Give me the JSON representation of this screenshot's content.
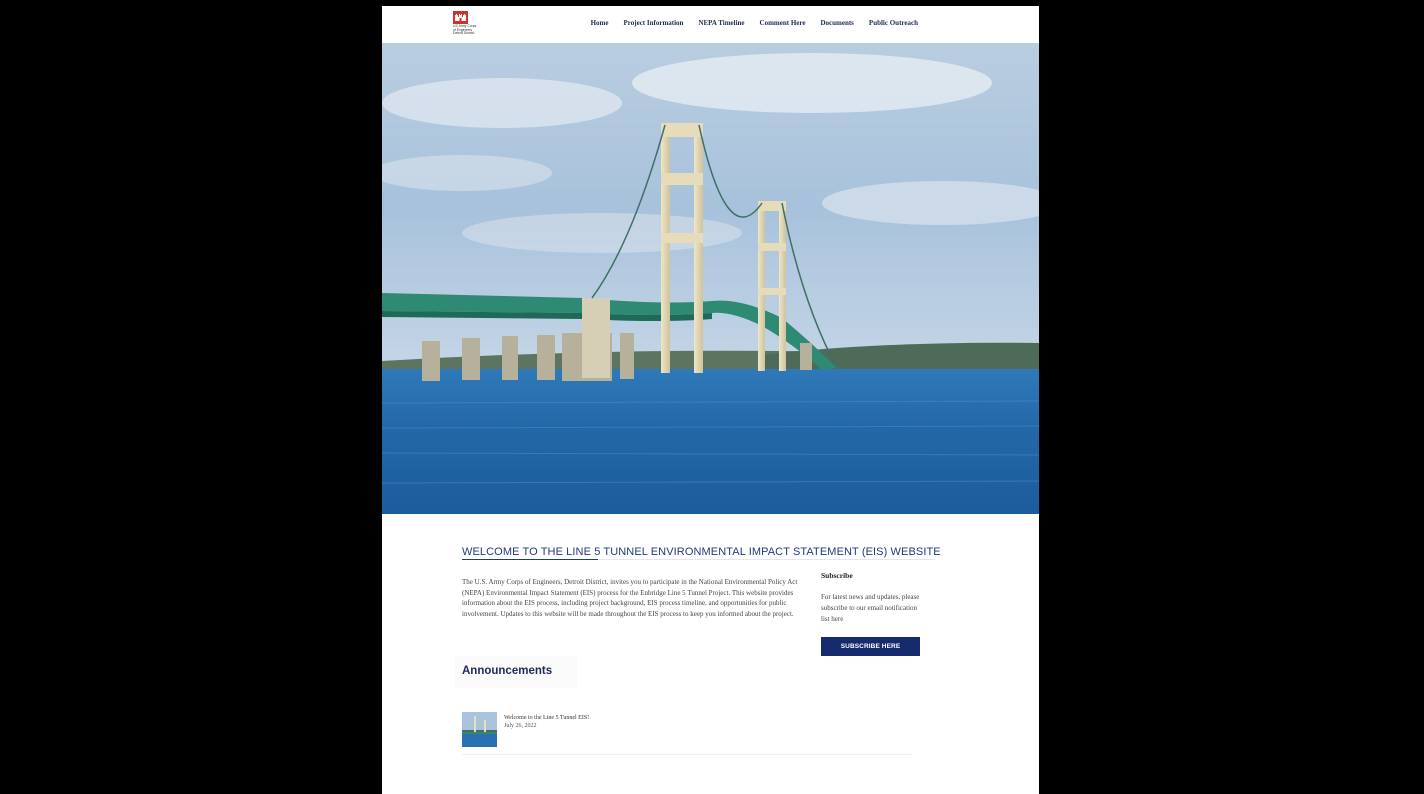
{
  "header": {
    "logo_lines": "US Army Corps\nof Engineers\nDetroit District",
    "nav": [
      "Home",
      "Project Information",
      "NEPA Timeline",
      "Comment Here",
      "Documents",
      "Public Outreach"
    ]
  },
  "main": {
    "welcome_heading": "WELCOME TO THE LINE 5 TUNNEL ENVIRONMENTAL IMPACT STATEMENT (EIS) WEBSITE",
    "intro_text": "The U.S. Army Corps of Engineers, Detroit District, invites you to participate in the National Environmental Policy Act (NEPA) Environmental Impact Statement (EIS) process for the Enbridge Line 5 Tunnel Project.  This website provides information about the EIS process, including project background, EIS process timeline, and opportunities for public involvement.  Updates to this website will be made throughout the EIS process to keep you informed about the project."
  },
  "subscribe": {
    "title": "Subscribe",
    "text": "For latest news and updates, please subscribe to our email notification list here",
    "button": "SUBSCRIBE HERE"
  },
  "announcements": {
    "title": "Announcements",
    "items": [
      {
        "title": "Welcome to the Line 5 Tunnel EIS!",
        "date": "July 26, 2022"
      }
    ]
  },
  "colors": {
    "brand_red": "#d0312d",
    "nav_text": "#1d2b4f",
    "button_bg": "#162a6e",
    "heading_blue": "#1f3b7a"
  },
  "icons": {
    "logo": "usace-castle-logo",
    "hero": "mackinac-bridge-photo",
    "thumbnail": "bridge-thumbnail"
  }
}
